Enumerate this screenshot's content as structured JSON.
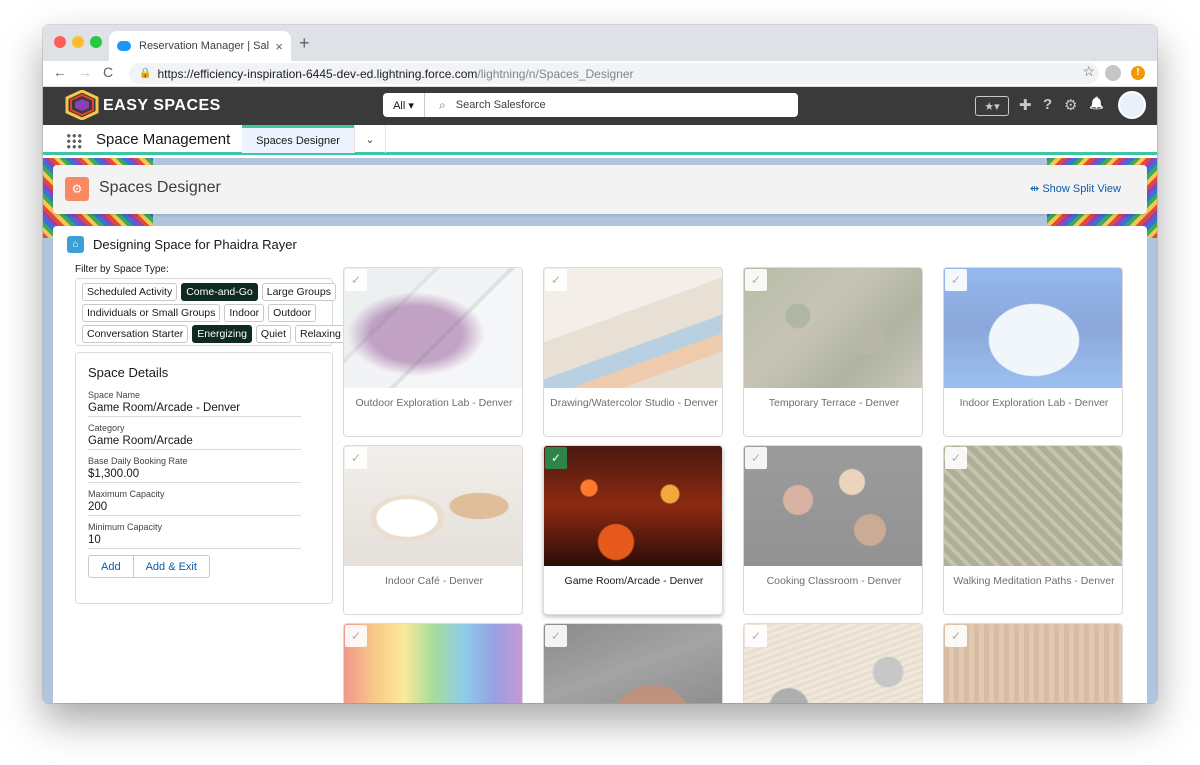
{
  "browser": {
    "tab_title": "Reservation Manager | Salesforce",
    "tab_close": "×",
    "new_tab": "+",
    "url_main": "https://efficiency-inspiration-6445-dev-ed.lightning.force.com",
    "url_path": "/lightning/n/Spaces_Designer",
    "nav": {
      "back": "←",
      "forward": "→",
      "reload": "C"
    },
    "star": "☆",
    "update_badge": "!"
  },
  "sf_header": {
    "brand": "EASY SPACES",
    "search_scope": "All ▾",
    "search_placeholder": "Search Salesforce",
    "icons": [
      "favorites-icon",
      "add-icon",
      "help-icon",
      "setup-gear-icon",
      "notification-bell-icon"
    ],
    "favorites_glyph": "★▾",
    "add_glyph": "✚",
    "help_glyph": "?",
    "gear_glyph": "⚙",
    "bell_glyph": "🔔"
  },
  "sf_nav": {
    "app_name": "Space Management",
    "active_tab": "Spaces Designer",
    "chevron": "⌄"
  },
  "page_header": {
    "title": "Spaces Designer",
    "split_view": "⇹ Show Split View"
  },
  "card": {
    "title": "Designing Space for Phaidra Rayer",
    "filter_label": "Filter by Space Type:",
    "filters": [
      [
        {
          "label": "Scheduled Activity",
          "active": false
        },
        {
          "label": "Come-and-Go",
          "active": true
        },
        {
          "label": "Large Groups",
          "active": false
        }
      ],
      [
        {
          "label": "Individuals or Small Groups",
          "active": false
        },
        {
          "label": "Indoor",
          "active": false
        },
        {
          "label": "Outdoor",
          "active": false
        }
      ],
      [
        {
          "label": "Conversation Starter",
          "active": false
        },
        {
          "label": "Energizing",
          "active": true
        },
        {
          "label": "Quiet",
          "active": false
        },
        {
          "label": "Relaxing",
          "active": false
        }
      ]
    ],
    "details": {
      "title": "Space Details",
      "fields": [
        {
          "label": "Space Name",
          "value": "Game Room/Arcade - Denver"
        },
        {
          "label": "Category",
          "value": "Game Room/Arcade"
        },
        {
          "label": "Base Daily Booking Rate",
          "value": "$1,300.00"
        },
        {
          "label": "Maximum Capacity",
          "value": "200"
        },
        {
          "label": "Minimum Capacity",
          "value": "10"
        }
      ],
      "add_button": "Add",
      "add_exit_button": "Add & Exit"
    }
  },
  "tiles": [
    {
      "label": "Outdoor Exploration Lab - Denver",
      "selected": false
    },
    {
      "label": "Drawing/Watercolor Studio - Denver",
      "selected": false
    },
    {
      "label": "Temporary Terrace - Denver",
      "selected": false
    },
    {
      "label": "Indoor Exploration Lab - Denver",
      "selected": false
    },
    {
      "label": "Indoor Café - Denver",
      "selected": false
    },
    {
      "label": "Game Room/Arcade - Denver",
      "selected": true
    },
    {
      "label": "Cooking Classroom - Denver",
      "selected": false
    },
    {
      "label": "Walking Meditation Paths - Denver",
      "selected": false
    },
    {
      "label": "",
      "selected": false
    },
    {
      "label": "",
      "selected": false
    },
    {
      "label": "",
      "selected": false
    },
    {
      "label": "",
      "selected": false
    }
  ],
  "check_glyph": "✓",
  "colors": {
    "accent_teal": "#3ec5a4",
    "active_pill": "#0f2b20",
    "selected_check": "#2e844a",
    "link_blue": "#0b5cab"
  }
}
